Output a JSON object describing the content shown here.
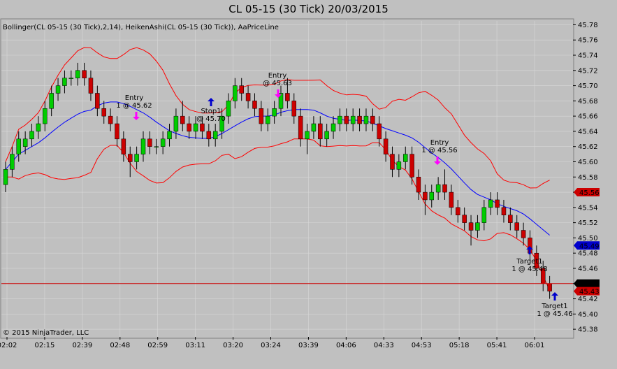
{
  "title": "CL 05-15 (30 Tick)  20/03/2015",
  "indicator_label": "Bollinger(CL 05-15 (30 Tick),2,14), HeikenAshi(CL 05-15 (30 Tick)), AaPriceLine",
  "copyright": "© 2015 NinjaTrader, LLC",
  "colors": {
    "up": "#00cc00",
    "down": "#cc0000",
    "band": "#ff0000",
    "mid": "#0000ff",
    "arrow_entry": "#ff00ff",
    "arrow_target": "#0000cc",
    "background": "#c0c0c0"
  },
  "chart_data": {
    "type": "candlestick",
    "ylim": [
      45.37,
      45.785
    ],
    "y_ticks": [
      "45.78",
      "45.76",
      "45.74",
      "45.72",
      "45.70",
      "45.68",
      "45.66",
      "45.64",
      "45.62",
      "45.60",
      "45.58",
      "45.56",
      "45.54",
      "45.52",
      "45.50",
      "45.48",
      "45.46",
      "45.44",
      "45.42",
      "45.40",
      "45.38"
    ],
    "x_ticks": [
      "02:02",
      "02:15",
      "02:39",
      "02:48",
      "02:59",
      "03:11",
      "03:20",
      "03:24",
      "03:39",
      "04:06",
      "04:33",
      "04:53",
      "05:18",
      "05:41",
      "06:01"
    ],
    "price_line": 45.44,
    "price_badges": [
      {
        "label": "45.56",
        "value": 45.56,
        "color": "#cc0000"
      },
      {
        "label": "45.49",
        "value": 45.49,
        "color": "#0000cc"
      },
      {
        "label": "45.44",
        "value": 45.44,
        "color": "#000000"
      },
      {
        "label": "45.43",
        "value": 45.43,
        "color": "#cc0000"
      }
    ],
    "candles": [
      {
        "o": 45.57,
        "h": 45.6,
        "l": 45.56,
        "c": 45.59
      },
      {
        "o": 45.59,
        "h": 45.62,
        "l": 45.58,
        "c": 45.61
      },
      {
        "o": 45.61,
        "h": 45.64,
        "l": 45.6,
        "c": 45.63
      },
      {
        "o": 45.62,
        "h": 45.64,
        "l": 45.61,
        "c": 45.63
      },
      {
        "o": 45.63,
        "h": 45.65,
        "l": 45.62,
        "c": 45.64
      },
      {
        "o": 45.64,
        "h": 45.66,
        "l": 45.63,
        "c": 45.65
      },
      {
        "o": 45.65,
        "h": 45.68,
        "l": 45.64,
        "c": 45.67
      },
      {
        "o": 45.67,
        "h": 45.7,
        "l": 45.66,
        "c": 45.69
      },
      {
        "o": 45.69,
        "h": 45.71,
        "l": 45.68,
        "c": 45.7
      },
      {
        "o": 45.7,
        "h": 45.72,
        "l": 45.69,
        "c": 45.71
      },
      {
        "o": 45.71,
        "h": 45.72,
        "l": 45.7,
        "c": 45.71
      },
      {
        "o": 45.71,
        "h": 45.73,
        "l": 45.7,
        "c": 45.72
      },
      {
        "o": 45.72,
        "h": 45.73,
        "l": 45.7,
        "c": 45.71
      },
      {
        "o": 45.71,
        "h": 45.72,
        "l": 45.68,
        "c": 45.69
      },
      {
        "o": 45.69,
        "h": 45.7,
        "l": 45.66,
        "c": 45.67
      },
      {
        "o": 45.67,
        "h": 45.68,
        "l": 45.65,
        "c": 45.66
      },
      {
        "o": 45.66,
        "h": 45.67,
        "l": 45.64,
        "c": 45.65
      },
      {
        "o": 45.65,
        "h": 45.66,
        "l": 45.62,
        "c": 45.63
      },
      {
        "o": 45.63,
        "h": 45.64,
        "l": 45.6,
        "c": 45.61
      },
      {
        "o": 45.61,
        "h": 45.62,
        "l": 45.58,
        "c": 45.6
      },
      {
        "o": 45.6,
        "h": 45.62,
        "l": 45.59,
        "c": 45.61
      },
      {
        "o": 45.61,
        "h": 45.64,
        "l": 45.6,
        "c": 45.63
      },
      {
        "o": 45.63,
        "h": 45.64,
        "l": 45.61,
        "c": 45.62
      },
      {
        "o": 45.62,
        "h": 45.63,
        "l": 45.61,
        "c": 45.62
      },
      {
        "o": 45.62,
        "h": 45.64,
        "l": 45.61,
        "c": 45.63
      },
      {
        "o": 45.63,
        "h": 45.65,
        "l": 45.62,
        "c": 45.64
      },
      {
        "o": 45.64,
        "h": 45.67,
        "l": 45.63,
        "c": 45.66
      },
      {
        "o": 45.66,
        "h": 45.68,
        "l": 45.64,
        "c": 45.65
      },
      {
        "o": 45.65,
        "h": 45.66,
        "l": 45.63,
        "c": 45.64
      },
      {
        "o": 45.64,
        "h": 45.66,
        "l": 45.63,
        "c": 45.65
      },
      {
        "o": 45.65,
        "h": 45.66,
        "l": 45.63,
        "c": 45.64
      },
      {
        "o": 45.64,
        "h": 45.65,
        "l": 45.62,
        "c": 45.63
      },
      {
        "o": 45.63,
        "h": 45.65,
        "l": 45.62,
        "c": 45.64
      },
      {
        "o": 45.64,
        "h": 45.67,
        "l": 45.63,
        "c": 45.66
      },
      {
        "o": 45.66,
        "h": 45.69,
        "l": 45.65,
        "c": 45.68
      },
      {
        "o": 45.68,
        "h": 45.71,
        "l": 45.67,
        "c": 45.7
      },
      {
        "o": 45.7,
        "h": 45.71,
        "l": 45.68,
        "c": 45.69
      },
      {
        "o": 45.69,
        "h": 45.7,
        "l": 45.67,
        "c": 45.68
      },
      {
        "o": 45.68,
        "h": 45.69,
        "l": 45.66,
        "c": 45.67
      },
      {
        "o": 45.67,
        "h": 45.68,
        "l": 45.64,
        "c": 45.65
      },
      {
        "o": 45.65,
        "h": 45.67,
        "l": 45.64,
        "c": 45.66
      },
      {
        "o": 45.66,
        "h": 45.68,
        "l": 45.65,
        "c": 45.67
      },
      {
        "o": 45.67,
        "h": 45.7,
        "l": 45.66,
        "c": 45.69
      },
      {
        "o": 45.69,
        "h": 45.71,
        "l": 45.67,
        "c": 45.68
      },
      {
        "o": 45.68,
        "h": 45.69,
        "l": 45.65,
        "c": 45.66
      },
      {
        "o": 45.66,
        "h": 45.67,
        "l": 45.62,
        "c": 45.63
      },
      {
        "o": 45.63,
        "h": 45.65,
        "l": 45.61,
        "c": 45.64
      },
      {
        "o": 45.64,
        "h": 45.66,
        "l": 45.63,
        "c": 45.65
      },
      {
        "o": 45.65,
        "h": 45.66,
        "l": 45.62,
        "c": 45.63
      },
      {
        "o": 45.63,
        "h": 45.65,
        "l": 45.62,
        "c": 45.64
      },
      {
        "o": 45.64,
        "h": 45.66,
        "l": 45.63,
        "c": 45.65
      },
      {
        "o": 45.65,
        "h": 45.67,
        "l": 45.64,
        "c": 45.66
      },
      {
        "o": 45.66,
        "h": 45.67,
        "l": 45.64,
        "c": 45.65
      },
      {
        "o": 45.65,
        "h": 45.67,
        "l": 45.64,
        "c": 45.66
      },
      {
        "o": 45.66,
        "h": 45.67,
        "l": 45.64,
        "c": 45.65
      },
      {
        "o": 45.65,
        "h": 45.67,
        "l": 45.64,
        "c": 45.66
      },
      {
        "o": 45.66,
        "h": 45.67,
        "l": 45.64,
        "c": 45.65
      },
      {
        "o": 45.65,
        "h": 45.66,
        "l": 45.62,
        "c": 45.63
      },
      {
        "o": 45.63,
        "h": 45.64,
        "l": 45.6,
        "c": 45.61
      },
      {
        "o": 45.61,
        "h": 45.62,
        "l": 45.58,
        "c": 45.59
      },
      {
        "o": 45.59,
        "h": 45.61,
        "l": 45.58,
        "c": 45.6
      },
      {
        "o": 45.6,
        "h": 45.62,
        "l": 45.59,
        "c": 45.61
      },
      {
        "o": 45.61,
        "h": 45.62,
        "l": 45.57,
        "c": 45.58
      },
      {
        "o": 45.58,
        "h": 45.59,
        "l": 45.55,
        "c": 45.56
      },
      {
        "o": 45.56,
        "h": 45.57,
        "l": 45.53,
        "c": 45.55
      },
      {
        "o": 45.55,
        "h": 45.57,
        "l": 45.54,
        "c": 45.56
      },
      {
        "o": 45.56,
        "h": 45.58,
        "l": 45.55,
        "c": 45.57
      },
      {
        "o": 45.57,
        "h": 45.59,
        "l": 45.55,
        "c": 45.56
      },
      {
        "o": 45.56,
        "h": 45.57,
        "l": 45.53,
        "c": 45.54
      },
      {
        "o": 45.54,
        "h": 45.55,
        "l": 45.52,
        "c": 45.53
      },
      {
        "o": 45.53,
        "h": 45.54,
        "l": 45.51,
        "c": 45.52
      },
      {
        "o": 45.52,
        "h": 45.53,
        "l": 45.49,
        "c": 45.51
      },
      {
        "o": 45.51,
        "h": 45.53,
        "l": 45.5,
        "c": 45.52
      },
      {
        "o": 45.52,
        "h": 45.55,
        "l": 45.51,
        "c": 45.54
      },
      {
        "o": 45.54,
        "h": 45.56,
        "l": 45.53,
        "c": 45.55
      },
      {
        "o": 45.55,
        "h": 45.56,
        "l": 45.53,
        "c": 45.54
      },
      {
        "o": 45.54,
        "h": 45.55,
        "l": 45.52,
        "c": 45.53
      },
      {
        "o": 45.53,
        "h": 45.54,
        "l": 45.51,
        "c": 45.52
      },
      {
        "o": 45.52,
        "h": 45.53,
        "l": 45.5,
        "c": 45.51
      },
      {
        "o": 45.51,
        "h": 45.52,
        "l": 45.49,
        "c": 45.5
      },
      {
        "o": 45.5,
        "h": 45.51,
        "l": 45.47,
        "c": 45.48
      },
      {
        "o": 45.48,
        "h": 45.49,
        "l": 45.45,
        "c": 45.46
      },
      {
        "o": 45.46,
        "h": 45.47,
        "l": 45.43,
        "c": 45.44
      },
      {
        "o": 45.44,
        "h": 45.45,
        "l": 45.42,
        "c": 45.43
      }
    ],
    "annotations": [
      {
        "lines": [
          "Entry",
          "1 @ 45.62"
        ]
      },
      {
        "lines": [
          "Stop1",
          "@ 45.70"
        ]
      },
      {
        "lines": [
          "Entry",
          "@ 45.63"
        ]
      },
      {
        "lines": [
          "Entry",
          "1 @ 45.56"
        ]
      },
      {
        "lines": [
          "Target1",
          "1 @ 45.48"
        ]
      },
      {
        "lines": [
          "Target1",
          "1 @ 45.46"
        ]
      }
    ]
  }
}
